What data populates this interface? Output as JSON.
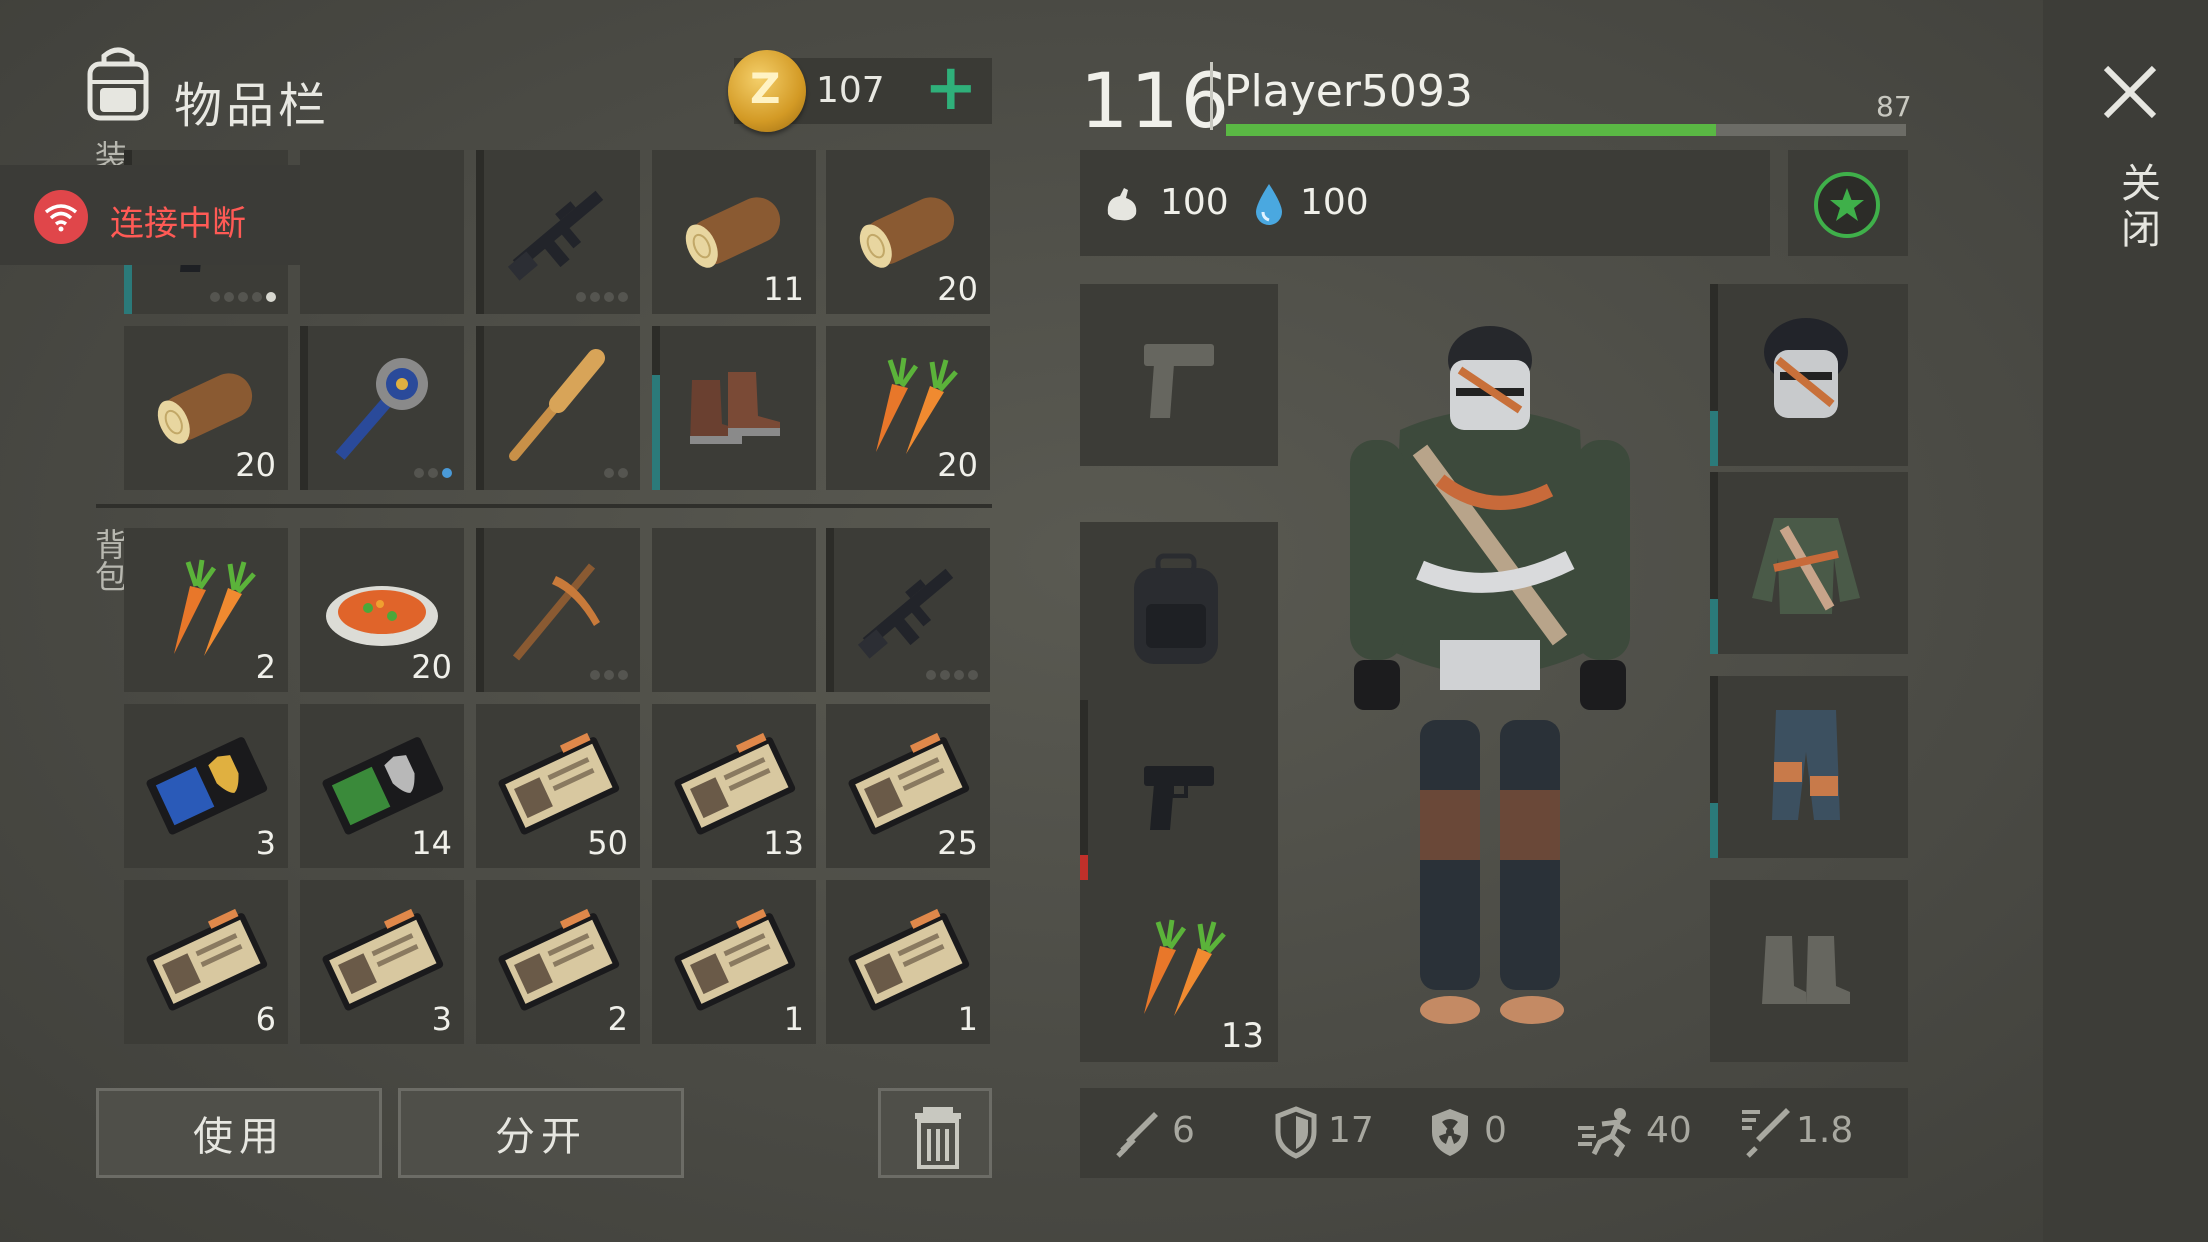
{
  "header": {
    "title": "物品栏",
    "coins": "107",
    "add_label": "+"
  },
  "connection": {
    "label": "连接中断"
  },
  "side_labels": {
    "hotbar": "装",
    "backpack": "背包"
  },
  "hotbar": [
    {
      "name": "pistol",
      "qty": "",
      "dots": [
        0,
        0,
        0,
        0,
        1
      ],
      "bar": 0.3
    },
    {
      "name": "empty",
      "qty": "",
      "dots": [],
      "bar": null
    },
    {
      "name": "assault-rifle",
      "qty": "",
      "dots": [
        0,
        0,
        0,
        0
      ],
      "bar": 0.0
    },
    {
      "name": "log",
      "qty": "11",
      "dots": [],
      "bar": null
    },
    {
      "name": "log",
      "qty": "20",
      "dots": [],
      "bar": null
    },
    {
      "name": "log",
      "qty": "20",
      "dots": [],
      "bar": null
    },
    {
      "name": "spiked-mace",
      "qty": "",
      "dots": [
        0,
        0,
        2
      ],
      "bar": 0.0
    },
    {
      "name": "baseball-bat",
      "qty": "",
      "dots": [
        0,
        0
      ],
      "bar": 0.0
    },
    {
      "name": "boots",
      "qty": "",
      "dots": [],
      "bar": 0.7
    },
    {
      "name": "carrot",
      "qty": "20",
      "dots": [],
      "bar": null
    }
  ],
  "backpack": [
    {
      "name": "carrot",
      "qty": "2",
      "dots": [],
      "bar": null
    },
    {
      "name": "stew",
      "qty": "20",
      "dots": [],
      "bar": null
    },
    {
      "name": "pickaxe",
      "qty": "",
      "dots": [
        0,
        0,
        0
      ],
      "bar": 0.0
    },
    {
      "name": "empty",
      "qty": "",
      "dots": [],
      "bar": null
    },
    {
      "name": "assault-rifle",
      "qty": "",
      "dots": [
        0,
        0,
        0,
        0
      ],
      "bar": 0.0
    },
    {
      "name": "police-badge-gold",
      "qty": "3",
      "dots": [],
      "bar": null
    },
    {
      "name": "police-badge-silver",
      "qty": "14",
      "dots": [],
      "bar": null
    },
    {
      "name": "patrol-id",
      "qty": "50",
      "dots": [],
      "bar": null
    },
    {
      "name": "patrol-id",
      "qty": "13",
      "dots": [],
      "bar": null
    },
    {
      "name": "patrol-id",
      "qty": "25",
      "dots": [],
      "bar": null
    },
    {
      "name": "patrol-id",
      "qty": "6",
      "dots": [],
      "bar": null
    },
    {
      "name": "patrol-id",
      "qty": "3",
      "dots": [],
      "bar": null
    },
    {
      "name": "patrol-id",
      "qty": "2",
      "dots": [],
      "bar": null
    },
    {
      "name": "patrol-id",
      "qty": "1",
      "dots": [],
      "bar": null
    },
    {
      "name": "patrol-id",
      "qty": "1",
      "dots": [],
      "bar": null
    }
  ],
  "actions": {
    "use": "使用",
    "split": "分开"
  },
  "player": {
    "level": "116",
    "name": "Player5093",
    "xp_value": "87",
    "xp_fraction": 0.72,
    "food": "100",
    "water": "100"
  },
  "equipment": {
    "left": [
      {
        "name": "pistol-slot-empty",
        "qty": ""
      },
      {
        "name": "backpack",
        "qty": ""
      },
      {
        "name": "pistol",
        "qty": ""
      },
      {
        "name": "carrot",
        "qty": "13"
      }
    ],
    "right": [
      {
        "name": "helmet",
        "qty": ""
      },
      {
        "name": "jacket",
        "qty": ""
      },
      {
        "name": "pants",
        "qty": ""
      },
      {
        "name": "boots-slot-empty",
        "qty": ""
      }
    ]
  },
  "stats": {
    "attack": "6",
    "defense": "17",
    "resist": "0",
    "speed": "40",
    "attack_speed": "1.8"
  },
  "close": {
    "label": "关闭"
  },
  "colors": {
    "accent_green": "#5ab844",
    "teal_bar": "#2b7a7a",
    "alert_red": "#e0464a"
  }
}
